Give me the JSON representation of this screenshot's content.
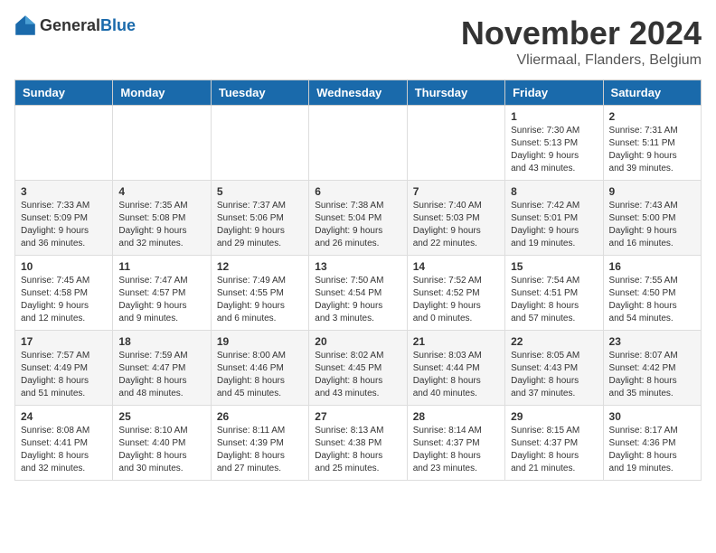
{
  "header": {
    "logo_general": "General",
    "logo_blue": "Blue",
    "month_title": "November 2024",
    "location": "Vliermaal, Flanders, Belgium"
  },
  "calendar": {
    "headers": [
      "Sunday",
      "Monday",
      "Tuesday",
      "Wednesday",
      "Thursday",
      "Friday",
      "Saturday"
    ],
    "weeks": [
      [
        {
          "day": "",
          "info": ""
        },
        {
          "day": "",
          "info": ""
        },
        {
          "day": "",
          "info": ""
        },
        {
          "day": "",
          "info": ""
        },
        {
          "day": "",
          "info": ""
        },
        {
          "day": "1",
          "info": "Sunrise: 7:30 AM\nSunset: 5:13 PM\nDaylight: 9 hours\nand 43 minutes."
        },
        {
          "day": "2",
          "info": "Sunrise: 7:31 AM\nSunset: 5:11 PM\nDaylight: 9 hours\nand 39 minutes."
        }
      ],
      [
        {
          "day": "3",
          "info": "Sunrise: 7:33 AM\nSunset: 5:09 PM\nDaylight: 9 hours\nand 36 minutes."
        },
        {
          "day": "4",
          "info": "Sunrise: 7:35 AM\nSunset: 5:08 PM\nDaylight: 9 hours\nand 32 minutes."
        },
        {
          "day": "5",
          "info": "Sunrise: 7:37 AM\nSunset: 5:06 PM\nDaylight: 9 hours\nand 29 minutes."
        },
        {
          "day": "6",
          "info": "Sunrise: 7:38 AM\nSunset: 5:04 PM\nDaylight: 9 hours\nand 26 minutes."
        },
        {
          "day": "7",
          "info": "Sunrise: 7:40 AM\nSunset: 5:03 PM\nDaylight: 9 hours\nand 22 minutes."
        },
        {
          "day": "8",
          "info": "Sunrise: 7:42 AM\nSunset: 5:01 PM\nDaylight: 9 hours\nand 19 minutes."
        },
        {
          "day": "9",
          "info": "Sunrise: 7:43 AM\nSunset: 5:00 PM\nDaylight: 9 hours\nand 16 minutes."
        }
      ],
      [
        {
          "day": "10",
          "info": "Sunrise: 7:45 AM\nSunset: 4:58 PM\nDaylight: 9 hours\nand 12 minutes."
        },
        {
          "day": "11",
          "info": "Sunrise: 7:47 AM\nSunset: 4:57 PM\nDaylight: 9 hours\nand 9 minutes."
        },
        {
          "day": "12",
          "info": "Sunrise: 7:49 AM\nSunset: 4:55 PM\nDaylight: 9 hours\nand 6 minutes."
        },
        {
          "day": "13",
          "info": "Sunrise: 7:50 AM\nSunset: 4:54 PM\nDaylight: 9 hours\nand 3 minutes."
        },
        {
          "day": "14",
          "info": "Sunrise: 7:52 AM\nSunset: 4:52 PM\nDaylight: 9 hours\nand 0 minutes."
        },
        {
          "day": "15",
          "info": "Sunrise: 7:54 AM\nSunset: 4:51 PM\nDaylight: 8 hours\nand 57 minutes."
        },
        {
          "day": "16",
          "info": "Sunrise: 7:55 AM\nSunset: 4:50 PM\nDaylight: 8 hours\nand 54 minutes."
        }
      ],
      [
        {
          "day": "17",
          "info": "Sunrise: 7:57 AM\nSunset: 4:49 PM\nDaylight: 8 hours\nand 51 minutes."
        },
        {
          "day": "18",
          "info": "Sunrise: 7:59 AM\nSunset: 4:47 PM\nDaylight: 8 hours\nand 48 minutes."
        },
        {
          "day": "19",
          "info": "Sunrise: 8:00 AM\nSunset: 4:46 PM\nDaylight: 8 hours\nand 45 minutes."
        },
        {
          "day": "20",
          "info": "Sunrise: 8:02 AM\nSunset: 4:45 PM\nDaylight: 8 hours\nand 43 minutes."
        },
        {
          "day": "21",
          "info": "Sunrise: 8:03 AM\nSunset: 4:44 PM\nDaylight: 8 hours\nand 40 minutes."
        },
        {
          "day": "22",
          "info": "Sunrise: 8:05 AM\nSunset: 4:43 PM\nDaylight: 8 hours\nand 37 minutes."
        },
        {
          "day": "23",
          "info": "Sunrise: 8:07 AM\nSunset: 4:42 PM\nDaylight: 8 hours\nand 35 minutes."
        }
      ],
      [
        {
          "day": "24",
          "info": "Sunrise: 8:08 AM\nSunset: 4:41 PM\nDaylight: 8 hours\nand 32 minutes."
        },
        {
          "day": "25",
          "info": "Sunrise: 8:10 AM\nSunset: 4:40 PM\nDaylight: 8 hours\nand 30 minutes."
        },
        {
          "day": "26",
          "info": "Sunrise: 8:11 AM\nSunset: 4:39 PM\nDaylight: 8 hours\nand 27 minutes."
        },
        {
          "day": "27",
          "info": "Sunrise: 8:13 AM\nSunset: 4:38 PM\nDaylight: 8 hours\nand 25 minutes."
        },
        {
          "day": "28",
          "info": "Sunrise: 8:14 AM\nSunset: 4:37 PM\nDaylight: 8 hours\nand 23 minutes."
        },
        {
          "day": "29",
          "info": "Sunrise: 8:15 AM\nSunset: 4:37 PM\nDaylight: 8 hours\nand 21 minutes."
        },
        {
          "day": "30",
          "info": "Sunrise: 8:17 AM\nSunset: 4:36 PM\nDaylight: 8 hours\nand 19 minutes."
        }
      ]
    ]
  }
}
